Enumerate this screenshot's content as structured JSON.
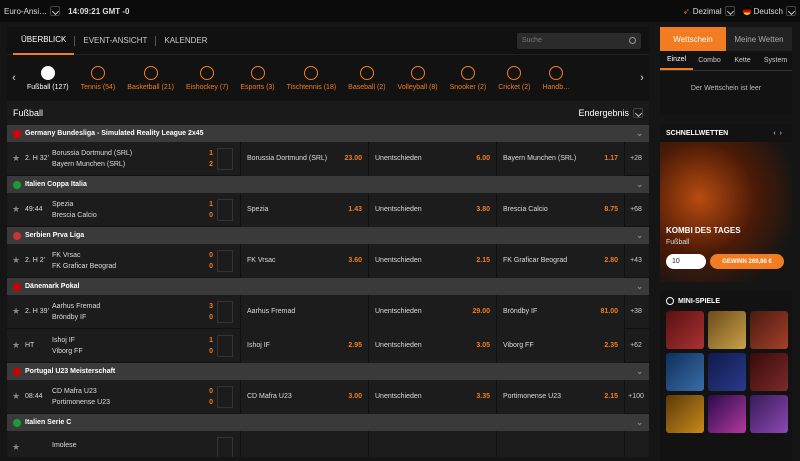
{
  "topbar": {
    "region": "Euro-Ansi…",
    "clock": "14:09:21 GMT -0",
    "odds_format": "Dezimal",
    "language": "Deutsch"
  },
  "nav": {
    "tabs": [
      "ÜBERBLICK",
      "EVENT-ANSICHT",
      "KALENDER"
    ],
    "search_placeholder": "Suche"
  },
  "sports": [
    {
      "label": "Fußball (127)"
    },
    {
      "label": "Tennis (54)"
    },
    {
      "label": "Basketball (21)"
    },
    {
      "label": "Eishockey (7)"
    },
    {
      "label": "Esports (3)"
    },
    {
      "label": "Tischtennis (18)"
    },
    {
      "label": "Baseball (2)"
    },
    {
      "label": "Volleyball (8)"
    },
    {
      "label": "Snooker (2)"
    },
    {
      "label": "Cricket (2)"
    },
    {
      "label": "Handb…"
    }
  ],
  "section": {
    "title": "Fußball",
    "sort": "Endergebnis"
  },
  "leagues": [
    {
      "name": "Germany Bundesliga - Simulated Reality League 2x45",
      "flag": "#d00",
      "matches": [
        {
          "time": "2. H 32'",
          "home": "Borussia Dortmund (SRL)",
          "away": "Bayern Munchen (SRL)",
          "s1": "1",
          "s2": "2",
          "o1n": "Borussia Dortmund (SRL)",
          "o1": "23.00",
          "oxn": "Unentschieden",
          "ox": "6.00",
          "o2n": "Bayern Munchen (SRL)",
          "o2": "1.17",
          "more": "+28"
        }
      ]
    },
    {
      "name": "Italien Coppa Italia",
      "flag": "#1a9c3a",
      "matches": [
        {
          "time": "49:44",
          "home": "Spezia",
          "away": "Brescia Calcio",
          "s1": "1",
          "s2": "0",
          "o1n": "Spezia",
          "o1": "1.43",
          "oxn": "Unentschieden",
          "ox": "3.80",
          "o2n": "Brescia Calcio",
          "o2": "8.75",
          "more": "+68"
        }
      ]
    },
    {
      "name": "Serbien Prva Liga",
      "flag": "#c33",
      "matches": [
        {
          "time": "2. H 2'",
          "home": "FK Vrsac",
          "away": "FK Graficar Beograd",
          "s1": "0",
          "s2": "0",
          "o1n": "FK Vrsac",
          "o1": "3.60",
          "oxn": "Unentschieden",
          "ox": "2.15",
          "o2n": "FK Graficar Beograd",
          "o2": "2.80",
          "more": "+43"
        }
      ]
    },
    {
      "name": "Dänemark Pokal",
      "flag": "#c00",
      "matches": [
        {
          "time": "2. H 39'",
          "home": "Aarhus Fremad",
          "away": "Bröndby IF",
          "s1": "3",
          "s2": "0",
          "o1n": "Aarhus Fremad",
          "o1": "",
          "oxn": "Unentschieden",
          "ox": "29.00",
          "o2n": "Bröndby IF",
          "o2": "81.00",
          "more": "+38"
        },
        {
          "time": "HT",
          "home": "Ishoj IF",
          "away": "Viborg FF",
          "s1": "1",
          "s2": "0",
          "o1n": "Ishoj IF",
          "o1": "2.95",
          "oxn": "Unentschieden",
          "ox": "3.05",
          "o2n": "Viborg FF",
          "o2": "2.35",
          "more": "+62"
        }
      ]
    },
    {
      "name": "Portugal U23 Meisterschaft",
      "flag": "#c00",
      "matches": [
        {
          "time": "08:44",
          "home": "CD Mafra U23",
          "away": "Portimonense U23",
          "s1": "0",
          "s2": "0",
          "o1n": "CD Mafra U23",
          "o1": "3.00",
          "oxn": "Unentschieden",
          "ox": "3.35",
          "o2n": "Portimonense U23",
          "o2": "2.15",
          "more": "+100"
        }
      ]
    },
    {
      "name": "Italien Serie C",
      "flag": "#1a9c3a",
      "matches": [
        {
          "time": "",
          "home": "Imolese",
          "away": "",
          "s1": "",
          "s2": "",
          "o1n": "",
          "o1": "",
          "oxn": "",
          "ox": "",
          "o2n": "",
          "o2": "",
          "more": ""
        }
      ]
    }
  ],
  "betslip": {
    "tab_active": "Wettschein",
    "tab_other": "Meine Wetten",
    "sub": [
      "Einzel",
      "Combo",
      "Kette",
      "System"
    ],
    "empty": "Der Wettschein ist leer"
  },
  "quickbets": {
    "title": "SCHNELLWETTEN",
    "promo_title": "KOMBI DES TAGES",
    "promo_sport": "Fußball",
    "stake": "10",
    "win": "GEWINN 269,86 €"
  },
  "mini": {
    "title": "MINI-SPIELE"
  }
}
